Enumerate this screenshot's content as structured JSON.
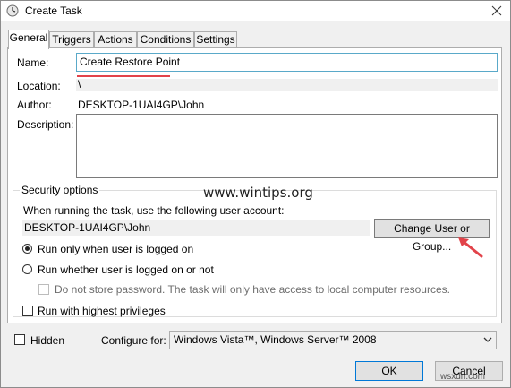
{
  "window": {
    "title": "Create Task",
    "icon": "clock-icon"
  },
  "tabs": [
    {
      "label": "General",
      "active": true
    },
    {
      "label": "Triggers",
      "active": false
    },
    {
      "label": "Actions",
      "active": false
    },
    {
      "label": "Conditions",
      "active": false
    },
    {
      "label": "Settings",
      "active": false
    }
  ],
  "general": {
    "name_label": "Name:",
    "name_value": "Create Restore Point",
    "location_label": "Location:",
    "location_value": "\\",
    "author_label": "Author:",
    "author_value": "DESKTOP-1UAI4GP\\John",
    "description_label": "Description:",
    "description_value": ""
  },
  "security": {
    "group_title": "Security options",
    "account_prompt": "When running the task, use the following user account:",
    "account_value": "DESKTOP-1UAI4GP\\John",
    "change_button": "Change User or Group...",
    "radio_logged_on": "Run only when user is logged on",
    "radio_logged_on_checked": true,
    "radio_whether": "Run whether user is logged on or not",
    "radio_whether_checked": false,
    "no_store_password": "Do not store password.  The task will only have access to local computer resources.",
    "highest_privileges": "Run with highest privileges"
  },
  "footer": {
    "hidden_label": "Hidden",
    "configure_label": "Configure for:",
    "configure_value": "Windows Vista™, Windows Server™ 2008",
    "ok_button": "OK",
    "cancel_button": "Cancel"
  },
  "watermarks": {
    "main": "www.wintips.org",
    "corner": "wsxdn.com"
  },
  "colors": {
    "annotation_red": "#e2434a",
    "focus_border": "#5aa9c9",
    "default_button_border": "#0078d7"
  }
}
